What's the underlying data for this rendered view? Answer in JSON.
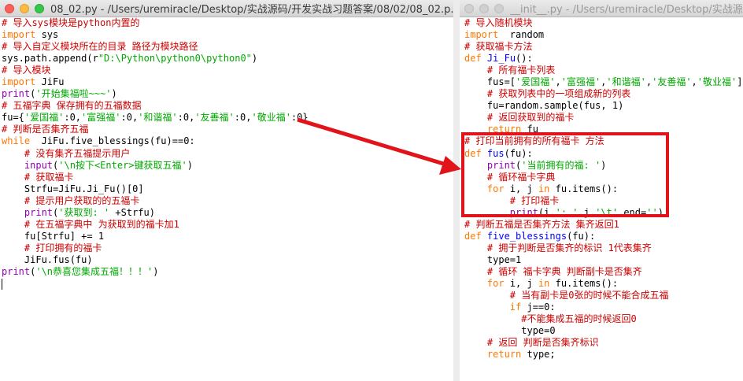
{
  "left_window": {
    "title": "08_02.py - /Users/uremiracle/Desktop/实战源码/开发实战习题答案/08/02/08_02.p...",
    "lines": [
      [
        {
          "t": "# 导入sys模块是python内置的",
          "c": "c"
        }
      ],
      [
        {
          "t": "import",
          "c": "k"
        },
        {
          "t": " sys",
          "c": ""
        }
      ],
      [
        {
          "t": "# 导入自定义模块所在的目录 路径为模块路径",
          "c": "c"
        }
      ],
      [
        {
          "t": "sys.path.append(r",
          "c": ""
        },
        {
          "t": "\"D:\\Python\\python0\\python0\"",
          "c": "s"
        },
        {
          "t": ")",
          "c": ""
        }
      ],
      [
        {
          "t": "# 导入模块",
          "c": "c"
        }
      ],
      [
        {
          "t": "import",
          "c": "k"
        },
        {
          "t": " JiFu",
          "c": ""
        }
      ],
      [
        {
          "t": "print",
          "c": "b"
        },
        {
          "t": "(",
          "c": ""
        },
        {
          "t": "'开始集福啦~~~'",
          "c": "s"
        },
        {
          "t": ")",
          "c": ""
        }
      ],
      [
        {
          "t": "# 五福字典 保存拥有的五福数据",
          "c": "c"
        }
      ],
      [
        {
          "t": "fu={",
          "c": ""
        },
        {
          "t": "'爱国福'",
          "c": "s"
        },
        {
          "t": ":0,",
          "c": ""
        },
        {
          "t": "'富强福'",
          "c": "s"
        },
        {
          "t": ":0,",
          "c": ""
        },
        {
          "t": "'和谐福'",
          "c": "s"
        },
        {
          "t": ":0,",
          "c": ""
        },
        {
          "t": "'友善福'",
          "c": "s"
        },
        {
          "t": ":0,",
          "c": ""
        },
        {
          "t": "'敬业福'",
          "c": "s"
        },
        {
          "t": ":0}",
          "c": ""
        }
      ],
      [
        {
          "t": "# 判断是否集齐五福",
          "c": "c"
        }
      ],
      [
        {
          "t": "while",
          "c": "k"
        },
        {
          "t": "  JiFu.five_blessings(fu)==0:",
          "c": ""
        }
      ],
      [
        {
          "t": "    # 没有集齐五福提示用户",
          "c": "c"
        }
      ],
      [
        {
          "t": "    ",
          "c": ""
        },
        {
          "t": "input",
          "c": "b"
        },
        {
          "t": "(",
          "c": ""
        },
        {
          "t": "'\\n按下<Enter>键获取五福'",
          "c": "s"
        },
        {
          "t": ")",
          "c": ""
        }
      ],
      [
        {
          "t": "    # 获取福卡",
          "c": "c"
        }
      ],
      [
        {
          "t": "    Strfu=JiFu.Ji_Fu()[0]",
          "c": ""
        }
      ],
      [
        {
          "t": "    # 提示用户获取的的五福卡",
          "c": "c"
        }
      ],
      [
        {
          "t": "    ",
          "c": ""
        },
        {
          "t": "print",
          "c": "b"
        },
        {
          "t": "(",
          "c": ""
        },
        {
          "t": "'获取到: '",
          "c": "s"
        },
        {
          "t": " +Strfu)",
          "c": ""
        }
      ],
      [
        {
          "t": "    # 在五福字典中 为获取到的福卡加1",
          "c": "c"
        }
      ],
      [
        {
          "t": "    fu[Strfu] += 1",
          "c": ""
        }
      ],
      [
        {
          "t": "    # 打印拥有的福卡",
          "c": "c"
        }
      ],
      [
        {
          "t": "    JiFu.fus(fu)",
          "c": ""
        }
      ],
      [
        {
          "t": "print",
          "c": "b"
        },
        {
          "t": "(",
          "c": ""
        },
        {
          "t": "'\\n恭喜您集成五福！！！'",
          "c": "s"
        },
        {
          "t": ")",
          "c": ""
        }
      ]
    ]
  },
  "right_window": {
    "title": "__init__.py - /Users/uremiracle/Desktop/实战源码/",
    "lines": [
      [
        {
          "t": "# 导入随机模块",
          "c": "c"
        }
      ],
      [
        {
          "t": "import",
          "c": "k"
        },
        {
          "t": "  random",
          "c": ""
        }
      ],
      [
        {
          "t": "# 获取福卡方法",
          "c": "c"
        }
      ],
      [
        {
          "t": "def",
          "c": "k"
        },
        {
          "t": " ",
          "c": ""
        },
        {
          "t": "Ji_Fu",
          "c": "f"
        },
        {
          "t": "():",
          "c": ""
        }
      ],
      [
        {
          "t": "    # 所有福卡列表",
          "c": "c"
        }
      ],
      [
        {
          "t": "    fus=[",
          "c": ""
        },
        {
          "t": "'爱国福'",
          "c": "s"
        },
        {
          "t": ",",
          "c": ""
        },
        {
          "t": "'富强福'",
          "c": "s"
        },
        {
          "t": ",",
          "c": ""
        },
        {
          "t": "'和谐福'",
          "c": "s"
        },
        {
          "t": ",",
          "c": ""
        },
        {
          "t": "'友善福'",
          "c": "s"
        },
        {
          "t": ",",
          "c": ""
        },
        {
          "t": "'敬业福'",
          "c": "s"
        },
        {
          "t": "]",
          "c": ""
        }
      ],
      [
        {
          "t": "    # 获取列表中的一项组成新的列表",
          "c": "c"
        }
      ],
      [
        {
          "t": "    fu=random.sample(fus, 1)",
          "c": ""
        }
      ],
      [
        {
          "t": "    # 返回获取到的福卡",
          "c": "c"
        }
      ],
      [
        {
          "t": "    ",
          "c": ""
        },
        {
          "t": "return",
          "c": "k"
        },
        {
          "t": " fu",
          "c": ""
        }
      ],
      [
        {
          "t": "# 打印当前拥有的所有福卡 方法",
          "c": "c"
        }
      ],
      [
        {
          "t": "def",
          "c": "k"
        },
        {
          "t": " ",
          "c": ""
        },
        {
          "t": "fus",
          "c": "f"
        },
        {
          "t": "(fu):",
          "c": ""
        }
      ],
      [
        {
          "t": "    ",
          "c": ""
        },
        {
          "t": "print",
          "c": "b"
        },
        {
          "t": "(",
          "c": ""
        },
        {
          "t": "'当前拥有的福: '",
          "c": "s"
        },
        {
          "t": ")",
          "c": ""
        }
      ],
      [
        {
          "t": "    # 循环福卡字典",
          "c": "c"
        }
      ],
      [
        {
          "t": "    ",
          "c": ""
        },
        {
          "t": "for",
          "c": "k"
        },
        {
          "t": " i, j ",
          "c": ""
        },
        {
          "t": "in",
          "c": "k"
        },
        {
          "t": " fu.items():",
          "c": ""
        }
      ],
      [
        {
          "t": "        # 打印福卡",
          "c": "c"
        }
      ],
      [
        {
          "t": "        ",
          "c": ""
        },
        {
          "t": "print",
          "c": "b"
        },
        {
          "t": "(i,",
          "c": ""
        },
        {
          "t": "': '",
          "c": "s"
        },
        {
          "t": ",j,",
          "c": ""
        },
        {
          "t": "'\\t'",
          "c": "s"
        },
        {
          "t": ",end=",
          "c": ""
        },
        {
          "t": "''",
          "c": "s"
        },
        {
          "t": ")",
          "c": ""
        }
      ],
      [
        {
          "t": "# 判断五福是否集齐方法 集齐返回1",
          "c": "c"
        }
      ],
      [
        {
          "t": "def",
          "c": "k"
        },
        {
          "t": " ",
          "c": ""
        },
        {
          "t": "five_blessings",
          "c": "f"
        },
        {
          "t": "(fu):",
          "c": ""
        }
      ],
      [
        {
          "t": "    # 拥于判断是否集齐的标识 1代表集齐",
          "c": "c"
        }
      ],
      [
        {
          "t": "    type=1",
          "c": ""
        }
      ],
      [
        {
          "t": "    # 循环 福卡字典 判断副卡是否集齐",
          "c": "c"
        }
      ],
      [
        {
          "t": "    ",
          "c": ""
        },
        {
          "t": "for",
          "c": "k"
        },
        {
          "t": " i, j ",
          "c": ""
        },
        {
          "t": "in",
          "c": "k"
        },
        {
          "t": " fu.items():",
          "c": ""
        }
      ],
      [
        {
          "t": "        # 当有副卡是0张的时候不能合成五福",
          "c": "c"
        }
      ],
      [
        {
          "t": "        ",
          "c": ""
        },
        {
          "t": "if",
          "c": "k"
        },
        {
          "t": " j==0:",
          "c": ""
        }
      ],
      [
        {
          "t": "          #不能集成五福的时候返回0",
          "c": "c"
        }
      ],
      [
        {
          "t": "          type=0",
          "c": ""
        }
      ],
      [
        {
          "t": "    # 返回 判断是否集齐标识",
          "c": "c"
        }
      ],
      [
        {
          "t": "    ",
          "c": ""
        },
        {
          "t": "return",
          "c": "k"
        },
        {
          "t": " type;",
          "c": ""
        }
      ]
    ]
  },
  "colors": {
    "comment": "#cc0000",
    "keyword": "#ff7700",
    "string": "#00a800",
    "builtin": "#9000b0",
    "function": "#0000ff",
    "annotation": "#e2141b"
  }
}
